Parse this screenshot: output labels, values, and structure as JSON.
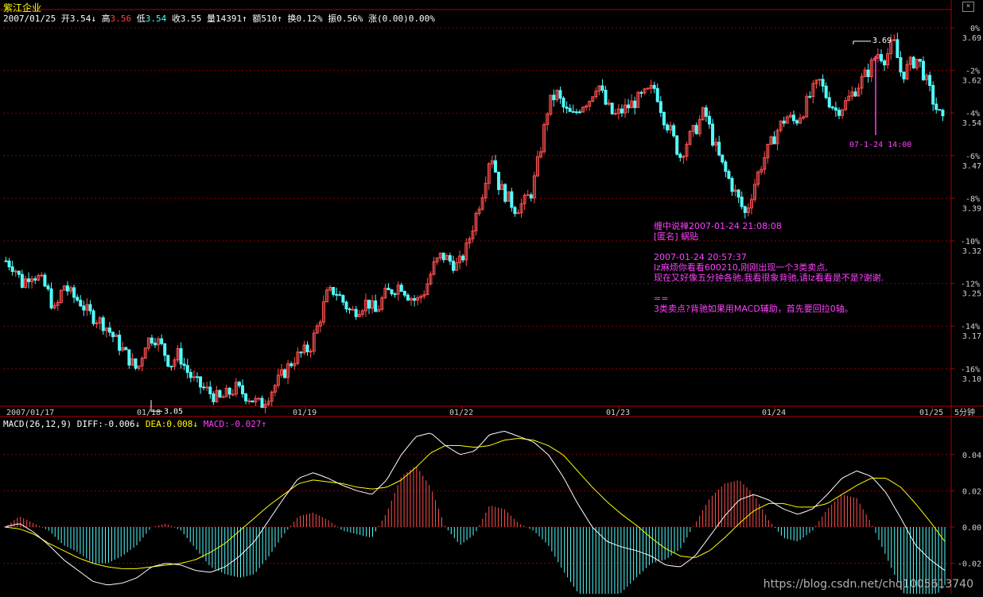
{
  "header": {
    "stock_name": "紫江企业",
    "date": "2007/01/25",
    "fields": [
      {
        "label": "开",
        "value": "3.54",
        "arrow": "↓",
        "color": "#ffffff"
      },
      {
        "label": "高",
        "value": "3.56",
        "arrow": "",
        "color": "#ff4040"
      },
      {
        "label": "低",
        "value": "3.54",
        "arrow": "",
        "color": "#40ffff"
      },
      {
        "label": "收",
        "value": "3.55",
        "arrow": "",
        "color": "#ffffff"
      },
      {
        "label": "量",
        "value": "14391",
        "arrow": "↑",
        "color": "#ffffff"
      },
      {
        "label": "额",
        "value": "510",
        "arrow": "↑",
        "color": "#ffffff"
      },
      {
        "label": "换",
        "value": "0.12%",
        "arrow": "",
        "color": "#ffffff"
      },
      {
        "label": "振",
        "value": "0.56%",
        "arrow": "",
        "color": "#ffffff"
      },
      {
        "label": "涨",
        "value": "(0.00)0.00%",
        "arrow": "",
        "color": "#ffffff"
      }
    ]
  },
  "period_label": "5分钟",
  "macd_header": {
    "name": "MACD(26,12,9)",
    "diff": "DIFF:-0.006↓",
    "dea": "DEA:0.008↓",
    "macd": "MACD:-0.027↑"
  },
  "annotation": {
    "lines": [
      "缠中说禅2007-01-24 21:08:08",
      "[匿名] 蜗贴",
      "",
      "2007-01-24 20:57:37",
      "lz麻烦你看看600210,刚刚出现一个3类卖点,",
      "现在又好像五分钟各驰,我看很象背驰,请lz看看是不是?谢谢.",
      "",
      "==",
      "3类卖点?背驰如果用MACD辅助，首先要回拉0轴。"
    ],
    "marker_label": "07-1-24  14:00"
  },
  "watermark": "https://blog.csdn.net/chq1005613740",
  "colors": {
    "up": "#ff5050",
    "down": "#54fcfc",
    "grid": "#8b0000",
    "axis": "#b00000",
    "diff": "#ffffff",
    "dea": "#ffff00",
    "macd_text": "#ff40ff",
    "annotation": "#ff40ff",
    "title": "#ffff00"
  },
  "chart_data": [
    {
      "type": "candlestick",
      "title": "紫江企业 5分钟",
      "x_labels": [
        "2007/01/17",
        "01/18",
        "01/19",
        "01/22",
        "01/23",
        "01/24",
        "01/25"
      ],
      "y_ticks": [
        "3.69",
        "3.62",
        "3.54",
        "3.47",
        "3.39",
        "3.32",
        "3.25",
        "3.17",
        "3.10"
      ],
      "pct_ticks": [
        "0%",
        "-2%",
        "-4%",
        "-6%",
        "-8%",
        "-10%",
        "-12%",
        "-14%",
        "-16%"
      ],
      "ylim": [
        3.06,
        3.72
      ],
      "high_marker": {
        "value": 3.69,
        "label": "3.69"
      },
      "low_marker": {
        "value": 3.05,
        "label": "3.05"
      },
      "close_path": [
        3.31,
        3.3,
        3.27,
        3.29,
        3.28,
        3.26,
        3.22,
        3.27,
        3.25,
        3.24,
        3.22,
        3.21,
        3.2,
        3.18,
        3.16,
        3.14,
        3.12,
        3.17,
        3.18,
        3.16,
        3.13,
        3.15,
        3.12,
        3.1,
        3.09,
        3.08,
        3.07,
        3.08,
        3.09,
        3.08,
        3.07,
        3.06,
        3.08,
        3.1,
        3.12,
        3.14,
        3.15,
        3.16,
        3.2,
        3.25,
        3.26,
        3.24,
        3.22,
        3.23,
        3.24,
        3.22,
        3.25,
        3.26,
        3.27,
        3.25,
        3.24,
        3.26,
        3.3,
        3.32,
        3.31,
        3.3,
        3.33,
        3.38,
        3.43,
        3.5,
        3.44,
        3.42,
        3.4,
        3.41,
        3.43,
        3.5,
        3.58,
        3.6,
        3.57,
        3.56,
        3.58,
        3.59,
        3.62,
        3.58,
        3.56,
        3.57,
        3.58,
        3.59,
        3.6,
        3.61,
        3.56,
        3.53,
        3.49,
        3.52,
        3.54,
        3.57,
        3.52,
        3.48,
        3.45,
        3.42,
        3.39,
        3.44,
        3.48,
        3.51,
        3.54,
        3.56,
        3.55,
        3.57,
        3.6,
        3.62,
        3.59,
        3.57,
        3.58,
        3.6,
        3.62,
        3.64,
        3.67,
        3.66,
        3.69,
        3.63,
        3.65,
        3.66,
        3.62,
        3.58,
        3.55
      ],
      "volume_note": "",
      "marker_value": 3.69
    },
    {
      "type": "macd",
      "title": "MACD(26,12,9)",
      "y_ticks": [
        "0.04",
        "0.02",
        "0.00",
        "-0.02"
      ],
      "ylim": [
        -0.036,
        0.054
      ],
      "diff": [
        0.0,
        0.002,
        -0.003,
        -0.01,
        -0.018,
        -0.024,
        -0.03,
        -0.032,
        -0.031,
        -0.028,
        -0.022,
        -0.02,
        -0.021,
        -0.024,
        -0.025,
        -0.022,
        -0.016,
        -0.008,
        0.004,
        0.016,
        0.027,
        0.03,
        0.027,
        0.023,
        0.02,
        0.018,
        0.026,
        0.04,
        0.05,
        0.052,
        0.045,
        0.04,
        0.042,
        0.051,
        0.053,
        0.05,
        0.047,
        0.04,
        0.028,
        0.013,
        0.0,
        -0.008,
        -0.011,
        -0.013,
        -0.016,
        -0.021,
        -0.022,
        -0.016,
        -0.005,
        0.006,
        0.015,
        0.018,
        0.015,
        0.01,
        0.007,
        0.01,
        0.018,
        0.027,
        0.031,
        0.028,
        0.019,
        0.005,
        -0.01,
        -0.018,
        -0.024
      ],
      "dea": [
        0.0,
        -0.001,
        -0.004,
        -0.009,
        -0.013,
        -0.017,
        -0.02,
        -0.022,
        -0.023,
        -0.023,
        -0.022,
        -0.021,
        -0.02,
        -0.018,
        -0.014,
        -0.009,
        -0.002,
        0.005,
        0.012,
        0.018,
        0.024,
        0.026,
        0.025,
        0.024,
        0.022,
        0.021,
        0.022,
        0.026,
        0.033,
        0.041,
        0.045,
        0.045,
        0.044,
        0.045,
        0.048,
        0.049,
        0.048,
        0.045,
        0.04,
        0.031,
        0.022,
        0.014,
        0.007,
        0.001,
        -0.006,
        -0.012,
        -0.016,
        -0.017,
        -0.013,
        -0.006,
        0.002,
        0.009,
        0.013,
        0.013,
        0.011,
        0.011,
        0.013,
        0.018,
        0.023,
        0.027,
        0.027,
        0.022,
        0.013,
        0.003,
        -0.008
      ],
      "last": {
        "diff": -0.006,
        "dea": 0.008,
        "macd": -0.027
      }
    }
  ]
}
